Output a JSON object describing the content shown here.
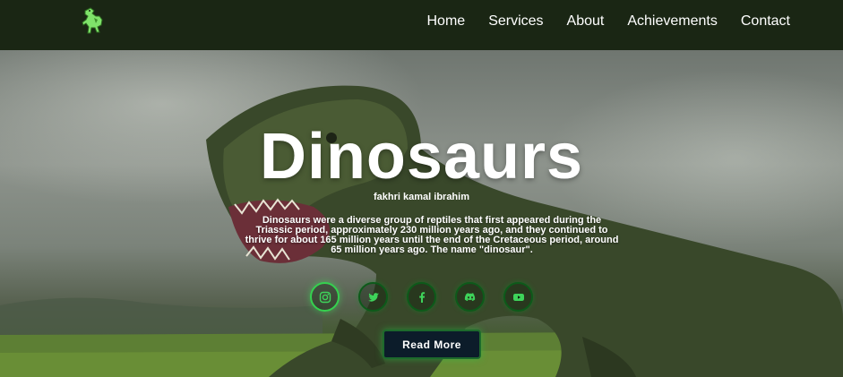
{
  "nav": {
    "logo_icon": "dinosaur-logo-icon",
    "links": [
      "Home",
      "Services",
      "About",
      "Achievements",
      "Contact"
    ]
  },
  "hero": {
    "title": "Dinosaurs",
    "subtitle": "fakhri kamal ibrahim",
    "description": "Dinosaurs were a diverse group of reptiles that first appeared during the Triassic period, approximately 230 million years ago, and they continued to thrive for about 165 million years until the end of the Cretaceous period, around 65 million years ago. The name \"dinosaur\".",
    "read_more": "Read More"
  },
  "socials": [
    {
      "icon": "instagram-icon"
    },
    {
      "icon": "twitter-icon"
    },
    {
      "icon": "facebook-icon"
    },
    {
      "icon": "discord-icon"
    },
    {
      "icon": "youtube-icon"
    }
  ],
  "colors": {
    "navbar": "#1a2614",
    "accent": "#35d24f",
    "button": "#0c1c2a"
  }
}
